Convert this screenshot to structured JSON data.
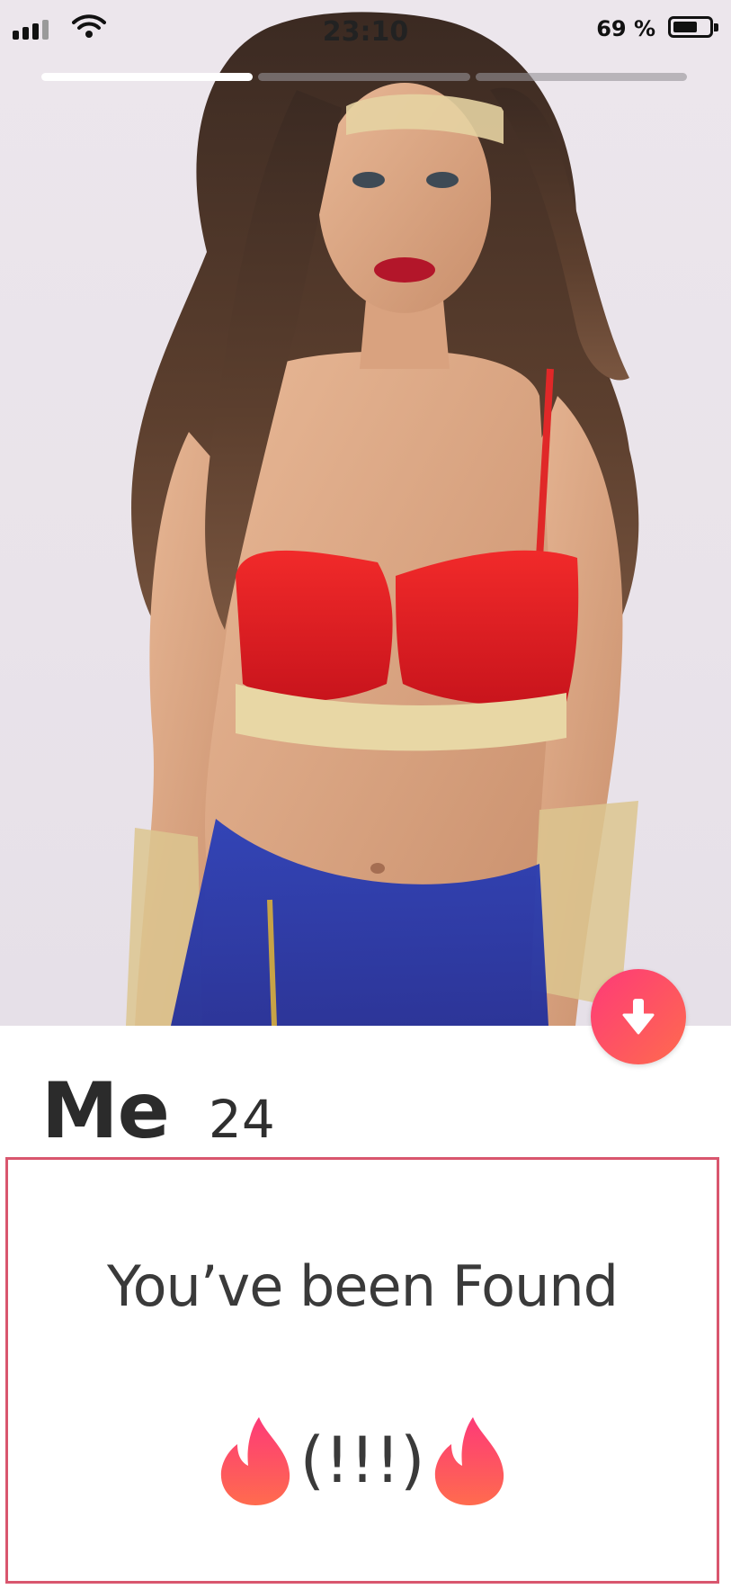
{
  "status_bar": {
    "time": "23:10",
    "battery_percent": "69 %",
    "battery_level": 0.69,
    "signal_bars": 4,
    "signal_active": 3
  },
  "photo": {
    "count": 3,
    "active_index": 0,
    "description": "profile photo"
  },
  "profile": {
    "name": "Me",
    "age": "24"
  },
  "bio": {
    "line1": "You’ve been Found",
    "line2": "(!!!)"
  },
  "icons": {
    "info_button": "arrow-down-icon",
    "flame": "flame-icon"
  },
  "colors": {
    "accent_start": "#fd3a78",
    "accent_end": "#ff6b4e",
    "bio_border": "#d9566e"
  }
}
